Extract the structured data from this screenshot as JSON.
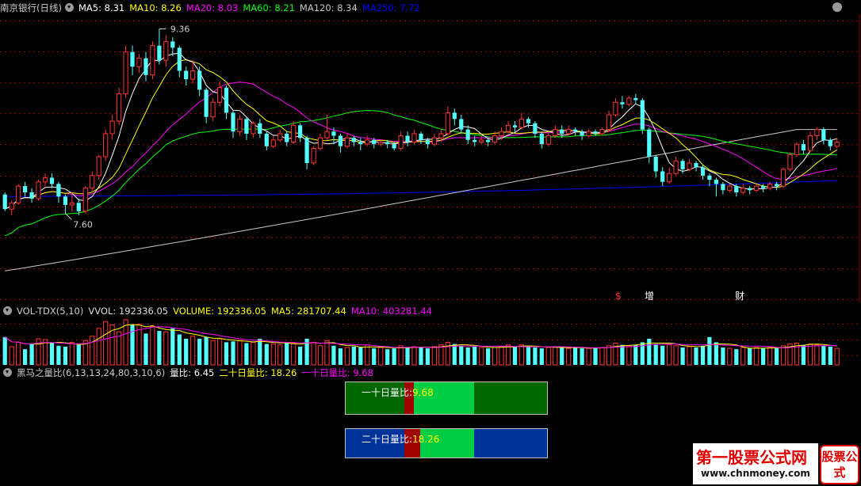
{
  "main_panel": {
    "stock": "南京银行(日线)",
    "ma": [
      {
        "label": "MA5: ",
        "value": "8.31",
        "color": "#ffffff"
      },
      {
        "label": "MA10: ",
        "value": "8.26",
        "color": "#ffff00"
      },
      {
        "label": "MA20: ",
        "value": "8.03",
        "color": "#ff00ff"
      },
      {
        "label": "MA60: ",
        "value": "8.21",
        "color": "#00ff00"
      },
      {
        "label": "MA120: ",
        "value": "8.34",
        "color": "#c8c8c8"
      },
      {
        "label": "MA250: ",
        "value": "7.72",
        "color": "#0000ff"
      }
    ],
    "high_label": "9.36",
    "low_label": "7.60",
    "markers": [
      {
        "text": "$",
        "color": "#ff3030"
      },
      {
        "text": "增",
        "color": "#ffffff"
      },
      {
        "text": "财",
        "color": "#ffffff"
      }
    ]
  },
  "vol_panel": {
    "title": "VOL-TDX(5,10)",
    "items": [
      {
        "label": "VVOL: ",
        "value": "192336.05",
        "color": "#dddddd"
      },
      {
        "label": "VOLUME: ",
        "value": "192336.05",
        "color": "#ffff00"
      },
      {
        "label": "MA5: ",
        "value": "281707.44",
        "color": "#ffff00"
      },
      {
        "label": "MA10: ",
        "value": "403281.44",
        "color": "#ff00ff"
      }
    ]
  },
  "ratio_panel": {
    "title": "黑马之量比(6,13,13,24,80,3,10,6)",
    "items": [
      {
        "label": "量比: ",
        "value": "6.45",
        "color": "#ffffff"
      },
      {
        "label": "二十日量比: ",
        "value": "18.26",
        "color": "#ffff00"
      },
      {
        "label": "一十日量比: ",
        "value": "9.68",
        "color": "#ff00ff"
      }
    ],
    "box1": {
      "label": "一十日量比:",
      "value": "9.68"
    },
    "box2": {
      "label": "二十日量比:",
      "value": "18.26"
    }
  },
  "colors": {
    "up": "#ff3232",
    "down": "#54ffff",
    "grid": "#8b0000",
    "ma5": "#ffffff",
    "ma10": "#ffff00",
    "ma20": "#ff00ff",
    "ma60": "#00ff00",
    "ma120": "#c8c8c8",
    "ma250": "#0000ff"
  },
  "watermark": {
    "title": "第一股票公式网",
    "url": "www.chnmoney.com",
    "badge": "股票公式"
  },
  "chart_data": {
    "type": "candlestick",
    "ylim": [
      6.75,
      9.5
    ],
    "ma_latest": {
      "MA5": 8.31,
      "MA10": 8.26,
      "MA20": 8.03,
      "MA60": 8.21,
      "MA120": 8.34,
      "MA250": 7.72
    },
    "high": 9.36,
    "low": 7.6,
    "candles": [
      [
        7.78,
        7.64,
        7.8,
        7.62
      ],
      [
        7.64,
        7.7,
        7.72,
        7.58
      ],
      [
        7.7,
        7.86,
        7.88,
        7.68
      ],
      [
        7.86,
        7.8,
        7.9,
        7.76
      ],
      [
        7.8,
        7.74,
        7.84,
        7.7
      ],
      [
        7.74,
        7.9,
        7.92,
        7.72
      ],
      [
        7.9,
        7.94,
        7.98,
        7.86
      ],
      [
        7.94,
        7.88,
        7.98,
        7.84
      ],
      [
        7.88,
        7.76,
        7.9,
        7.7
      ],
      [
        7.76,
        7.68,
        7.78,
        7.6
      ],
      [
        7.68,
        7.7,
        7.8,
        7.62
      ],
      [
        7.7,
        7.62,
        7.74,
        7.58
      ],
      [
        7.62,
        7.84,
        7.86,
        7.6
      ],
      [
        7.84,
        7.96,
        8.0,
        7.8
      ],
      [
        7.96,
        8.14,
        8.16,
        7.92
      ],
      [
        8.14,
        8.36,
        8.4,
        8.1
      ],
      [
        8.36,
        8.48,
        8.54,
        8.3
      ],
      [
        8.48,
        8.74,
        8.8,
        8.44
      ],
      [
        8.74,
        9.14,
        9.2,
        8.7
      ],
      [
        9.14,
        9.0,
        9.2,
        8.92
      ],
      [
        9.0,
        9.08,
        9.12,
        8.94
      ],
      [
        9.08,
        8.92,
        9.14,
        8.86
      ],
      [
        8.92,
        9.2,
        9.24,
        8.88
      ],
      [
        9.2,
        9.06,
        9.36,
        9.02
      ],
      [
        9.06,
        9.24,
        9.3,
        9.0
      ],
      [
        9.24,
        9.18,
        9.28,
        9.1
      ],
      [
        9.18,
        8.96,
        9.2,
        8.9
      ],
      [
        8.96,
        8.88,
        9.0,
        8.82
      ],
      [
        8.88,
        8.96,
        9.06,
        8.84
      ],
      [
        8.96,
        8.78,
        9.0,
        8.72
      ],
      [
        8.78,
        8.52,
        8.8,
        8.46
      ],
      [
        8.52,
        8.66,
        8.7,
        8.48
      ],
      [
        8.66,
        8.8,
        8.86,
        8.62
      ],
      [
        8.8,
        8.56,
        8.82,
        8.5
      ],
      [
        8.56,
        8.38,
        8.58,
        8.32
      ],
      [
        8.38,
        8.5,
        8.54,
        8.34
      ],
      [
        8.5,
        8.36,
        8.52,
        8.3
      ],
      [
        8.36,
        8.46,
        8.48,
        8.32
      ],
      [
        8.46,
        8.36,
        8.5,
        8.32
      ],
      [
        8.36,
        8.24,
        8.38,
        8.2
      ],
      [
        8.24,
        8.3,
        8.34,
        8.22
      ],
      [
        8.3,
        8.36,
        8.4,
        8.28
      ],
      [
        8.36,
        8.28,
        8.38,
        8.24
      ],
      [
        8.28,
        8.44,
        8.48,
        8.26
      ],
      [
        8.44,
        8.32,
        8.46,
        8.28
      ],
      [
        8.32,
        8.08,
        8.34,
        8.02
      ],
      [
        8.08,
        8.22,
        8.24,
        8.06
      ],
      [
        8.22,
        8.32,
        8.36,
        8.2
      ],
      [
        8.32,
        8.38,
        8.54,
        8.3
      ],
      [
        8.38,
        8.34,
        8.42,
        8.26
      ],
      [
        8.34,
        8.24,
        8.36,
        8.18
      ],
      [
        8.24,
        8.32,
        8.36,
        8.22
      ],
      [
        8.32,
        8.28,
        8.34,
        8.24
      ],
      [
        8.28,
        8.26,
        8.32,
        8.2
      ],
      [
        8.26,
        8.3,
        8.34,
        8.24
      ],
      [
        8.3,
        8.26,
        8.32,
        8.22
      ],
      [
        8.26,
        8.28,
        8.3,
        8.24
      ],
      [
        8.28,
        8.26,
        8.3,
        8.22
      ],
      [
        8.26,
        8.22,
        8.28,
        8.2
      ],
      [
        8.22,
        8.34,
        8.38,
        8.2
      ],
      [
        8.34,
        8.28,
        8.38,
        8.24
      ],
      [
        8.28,
        8.36,
        8.4,
        8.26
      ],
      [
        8.36,
        8.3,
        8.38,
        8.26
      ],
      [
        8.3,
        8.26,
        8.32,
        8.22
      ],
      [
        8.26,
        8.32,
        8.36,
        8.24
      ],
      [
        8.32,
        8.36,
        8.4,
        8.28
      ],
      [
        8.36,
        8.56,
        8.62,
        8.34
      ],
      [
        8.56,
        8.5,
        8.6,
        8.44
      ],
      [
        8.5,
        8.4,
        8.54,
        8.36
      ],
      [
        8.4,
        8.3,
        8.44,
        8.26
      ],
      [
        8.3,
        8.28,
        8.34,
        8.24
      ],
      [
        8.28,
        8.3,
        8.34,
        8.26
      ],
      [
        8.3,
        8.28,
        8.32,
        8.24
      ],
      [
        8.28,
        8.34,
        8.38,
        8.26
      ],
      [
        8.34,
        8.38,
        8.42,
        8.3
      ],
      [
        8.38,
        8.44,
        8.48,
        8.36
      ],
      [
        8.44,
        8.42,
        8.48,
        8.38
      ],
      [
        8.42,
        8.5,
        8.56,
        8.4
      ],
      [
        8.5,
        8.46,
        8.52,
        8.42
      ],
      [
        8.46,
        8.36,
        8.48,
        8.32
      ],
      [
        8.36,
        8.26,
        8.38,
        8.22
      ],
      [
        8.26,
        8.34,
        8.38,
        8.24
      ],
      [
        8.34,
        8.4,
        8.44,
        8.32
      ],
      [
        8.4,
        8.36,
        8.44,
        8.32
      ],
      [
        8.36,
        8.4,
        8.44,
        8.34
      ],
      [
        8.4,
        8.38,
        8.42,
        8.34
      ],
      [
        8.38,
        8.34,
        8.4,
        8.3
      ],
      [
        8.34,
        8.38,
        8.4,
        8.32
      ],
      [
        8.38,
        8.36,
        8.4,
        8.34
      ],
      [
        8.36,
        8.4,
        8.42,
        8.34
      ],
      [
        8.4,
        8.54,
        8.58,
        8.38
      ],
      [
        8.54,
        8.66,
        8.7,
        8.52
      ],
      [
        8.66,
        8.64,
        8.72,
        8.6
      ],
      [
        8.64,
        8.7,
        8.72,
        8.62
      ],
      [
        8.7,
        8.68,
        8.74,
        8.64
      ],
      [
        8.68,
        8.4,
        8.7,
        8.36
      ],
      [
        8.4,
        8.14,
        8.42,
        8.08
      ],
      [
        8.14,
        8.0,
        8.16,
        7.94
      ],
      [
        8.0,
        7.9,
        8.04,
        7.86
      ],
      [
        7.9,
        7.98,
        8.04,
        7.88
      ],
      [
        7.98,
        8.1,
        8.14,
        7.96
      ],
      [
        8.1,
        8.02,
        8.12,
        7.98
      ],
      [
        8.02,
        8.08,
        8.12,
        8.0
      ],
      [
        8.08,
        8.04,
        8.1,
        8.0
      ],
      [
        8.04,
        7.96,
        8.06,
        7.92
      ],
      [
        7.96,
        7.92,
        7.98,
        7.86
      ],
      [
        7.92,
        7.88,
        7.94,
        7.76
      ],
      [
        7.88,
        7.82,
        7.9,
        7.78
      ],
      [
        7.82,
        7.86,
        7.88,
        7.8
      ],
      [
        7.86,
        7.8,
        7.88,
        7.76
      ],
      [
        7.8,
        7.84,
        7.88,
        7.78
      ],
      [
        7.84,
        7.82,
        7.86,
        7.78
      ],
      [
        7.82,
        7.86,
        7.88,
        7.8
      ],
      [
        7.86,
        7.84,
        7.88,
        7.8
      ],
      [
        7.84,
        7.88,
        7.9,
        7.82
      ],
      [
        7.88,
        7.86,
        7.9,
        7.82
      ],
      [
        7.86,
        8.02,
        8.04,
        7.84
      ],
      [
        8.02,
        8.16,
        8.18,
        8.0
      ],
      [
        8.16,
        8.26,
        8.28,
        8.14
      ],
      [
        8.26,
        8.2,
        8.3,
        8.16
      ],
      [
        8.2,
        8.34,
        8.38,
        8.18
      ],
      [
        8.34,
        8.4,
        8.42,
        8.3
      ],
      [
        8.4,
        8.3,
        8.42,
        8.26
      ],
      [
        8.3,
        8.24,
        8.32,
        8.2
      ],
      [
        8.24,
        8.28,
        8.32,
        8.22
      ]
    ],
    "volume": [
      320,
      210,
      260,
      180,
      240,
      300,
      290,
      250,
      220,
      210,
      260,
      230,
      280,
      330,
      420,
      500,
      460,
      380,
      520,
      460,
      470,
      360,
      440,
      390,
      380,
      420,
      350,
      300,
      330,
      300,
      320,
      280,
      300,
      260,
      270,
      280,
      250,
      260,
      300,
      240,
      240,
      230,
      260,
      250,
      210,
      300,
      260,
      220,
      280,
      220,
      190,
      200,
      210,
      200,
      230,
      190,
      200,
      180,
      190,
      220,
      200,
      210,
      200,
      190,
      210,
      230,
      260,
      240,
      220,
      200,
      210,
      200,
      190,
      200,
      210,
      230,
      210,
      230,
      210,
      200,
      190,
      200,
      210,
      200,
      190,
      200,
      190,
      190,
      200,
      200,
      220,
      250,
      230,
      220,
      230,
      260,
      300,
      240,
      220,
      230,
      220,
      200,
      210,
      200,
      220,
      320,
      260,
      200,
      190,
      180,
      200,
      190,
      200,
      190,
      200,
      190,
      220,
      240,
      250,
      230,
      240,
      230,
      220,
      210,
      190
    ]
  }
}
